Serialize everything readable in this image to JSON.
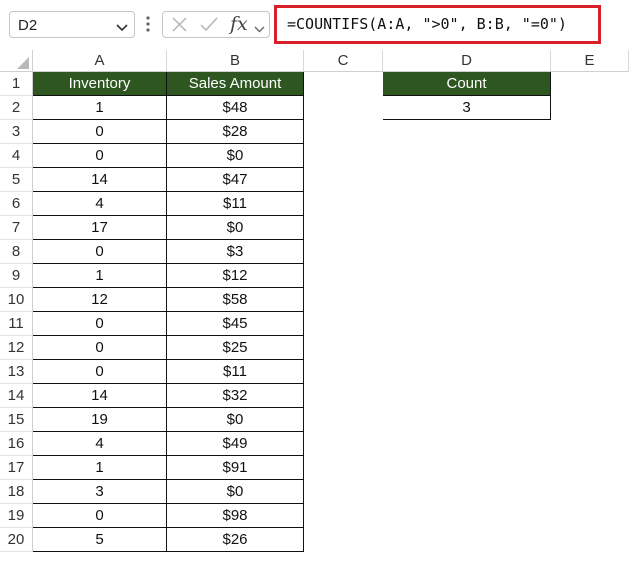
{
  "formula_bar": {
    "name_box": "D2",
    "fx_label": "fx",
    "formula": "=COUNTIFS(A:A, \">0\", B:B, \"=0\")",
    "highlight_color": "#d8202a"
  },
  "sheet": {
    "columns": [
      "A",
      "B",
      "C",
      "D",
      "E"
    ],
    "rows": [
      "1",
      "2",
      "3",
      "4",
      "5",
      "6",
      "7",
      "8",
      "9",
      "10",
      "11",
      "12",
      "13",
      "14",
      "15",
      "16",
      "17",
      "18",
      "19",
      "20"
    ],
    "header_fill": "#2d5620",
    "table": {
      "headers": [
        "Inventory",
        "Sales Amount"
      ],
      "rows": [
        [
          "1",
          "$48"
        ],
        [
          "0",
          "$28"
        ],
        [
          "0",
          "$0"
        ],
        [
          "14",
          "$47"
        ],
        [
          "4",
          "$11"
        ],
        [
          "17",
          "$0"
        ],
        [
          "0",
          "$3"
        ],
        [
          "1",
          "$12"
        ],
        [
          "12",
          "$58"
        ],
        [
          "0",
          "$45"
        ],
        [
          "0",
          "$25"
        ],
        [
          "0",
          "$11"
        ],
        [
          "14",
          "$32"
        ],
        [
          "19",
          "$0"
        ],
        [
          "4",
          "$49"
        ],
        [
          "1",
          "$91"
        ],
        [
          "3",
          "$0"
        ],
        [
          "0",
          "$98"
        ],
        [
          "5",
          "$26"
        ]
      ]
    },
    "count": {
      "header": "Count",
      "value": "3"
    }
  }
}
